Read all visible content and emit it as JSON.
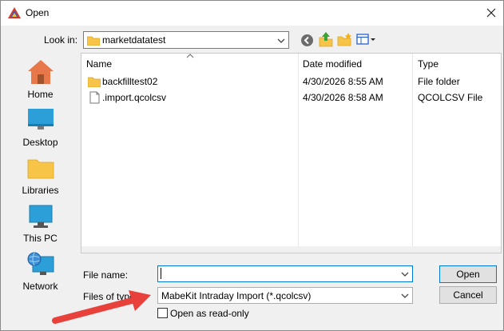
{
  "window": {
    "title": "Open"
  },
  "toolbar": {
    "look_in_label": "Look in:",
    "look_in_value": "marketdatatest"
  },
  "places": [
    {
      "label": "Home",
      "icon": "home-icon"
    },
    {
      "label": "Desktop",
      "icon": "desktop-icon"
    },
    {
      "label": "Libraries",
      "icon": "libraries-icon"
    },
    {
      "label": "This PC",
      "icon": "this-pc-icon"
    },
    {
      "label": "Network",
      "icon": "network-icon"
    }
  ],
  "file_list": {
    "columns": [
      "Name",
      "Date modified",
      "Type"
    ],
    "rows": [
      {
        "name": "backfilltest02",
        "date": "4/30/2026 8:55 AM",
        "type": "File folder",
        "icon": "folder-icon"
      },
      {
        "name": ".import.qcolcsv",
        "date": "4/30/2026 8:58 AM",
        "type": "QCOLCSV File",
        "icon": "file-icon"
      }
    ]
  },
  "form": {
    "file_name_label": "File name:",
    "file_name_value": "",
    "files_of_type_label": "Files of type:",
    "files_of_type_value": "MabeKit Intraday Import (*.qcolcsv)",
    "read_only_label": "Open as read-only",
    "read_only_checked": false
  },
  "buttons": {
    "open": "Open",
    "cancel": "Cancel"
  },
  "colors": {
    "accent": "#0078d7",
    "folder": "#f8c447",
    "arrow": "#e8413c"
  }
}
